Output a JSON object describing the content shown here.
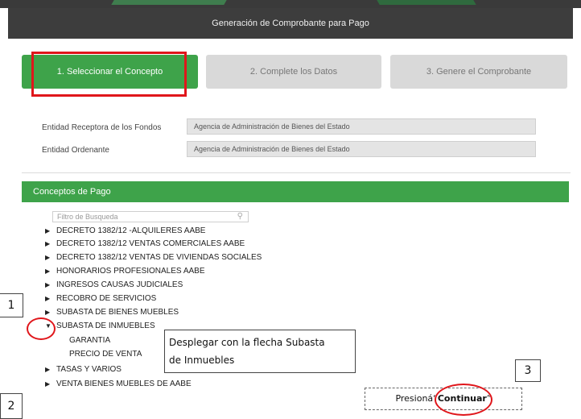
{
  "header": {
    "title": "Generación de Comprobante para Pago"
  },
  "steps": [
    {
      "label": "1. Seleccionar el Concepto"
    },
    {
      "label": "2. Complete los Datos"
    },
    {
      "label": "3. Genere el Comprobante"
    }
  ],
  "fields": {
    "receptora": {
      "label": "Entidad Receptora de los Fondos",
      "value": "Agencia de Administración de Bienes del Estado"
    },
    "ordenante": {
      "label": "Entidad Ordenante",
      "value": "Agencia de Administración de Bienes del Estado"
    }
  },
  "conceptos": {
    "title": "Conceptos de Pago",
    "filter_placeholder": "Filtro de Busqueda",
    "items": [
      "DECRETO 1382/12 -ALQUILERES AABE",
      "DECRETO 1382/12 VENTAS COMERCIALES AABE",
      "DECRETO 1382/12 VENTAS DE VIVIENDAS SOCIALES",
      "HONORARIOS PROFESIONALES AABE",
      "INGRESOS CAUSAS JUDICIALES",
      "RECOBRO DE SERVICIOS",
      "SUBASTA DE BIENES MUEBLES",
      "SUBASTA DE INMUEBLES",
      "TASAS Y VARIOS",
      "VENTA BIENES MUEBLES DE AABE"
    ],
    "children": [
      "GARANTIA",
      "PRECIO DE VENTA"
    ]
  },
  "annotations": {
    "n1": "1",
    "n2": "2",
    "n3": "3",
    "callout_line1": "Desplegar con la flecha Subasta",
    "callout_line2": "de Inmuebles",
    "continue_prefix": "Presioná“",
    "continue_bold": "Continuar",
    "continue_suffix": "”"
  },
  "colors": {
    "accent": "#3ea34a",
    "header": "#3d3d3d",
    "highlight": "#e0161b"
  },
  "icons": {
    "collapsed": "triangle-right-icon",
    "expanded": "triangle-down-icon",
    "search": "search-icon"
  }
}
